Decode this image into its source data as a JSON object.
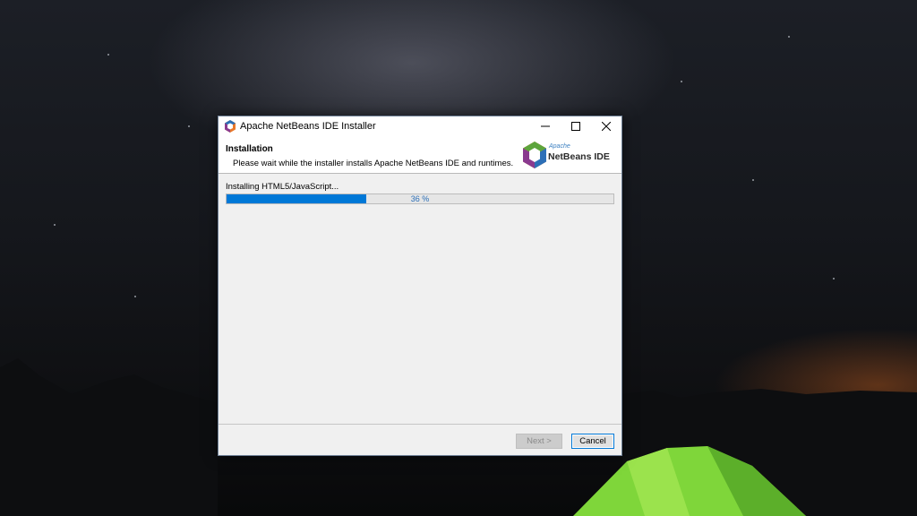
{
  "window": {
    "title": "Apache NetBeans IDE Installer",
    "controls": {
      "minimize_icon": "minimize-icon",
      "maximize_icon": "maximize-icon",
      "close_icon": "close-icon"
    }
  },
  "header": {
    "title": "Installation",
    "subtitle": "Please wait while the installer installs Apache NetBeans IDE and runtimes.",
    "logo": {
      "apache": "Apache",
      "name": "NetBeans IDE"
    }
  },
  "progress": {
    "status": "Installing HTML5/JavaScript...",
    "percent": 36,
    "label": "36 %"
  },
  "buttons": {
    "next": "Next >",
    "cancel": "Cancel"
  },
  "colors": {
    "accent": "#0078d7",
    "logo_orange": "#e8782a",
    "logo_blue": "#2c6fb7",
    "logo_purple": "#8a3a8f",
    "logo_green": "#5da53c"
  }
}
